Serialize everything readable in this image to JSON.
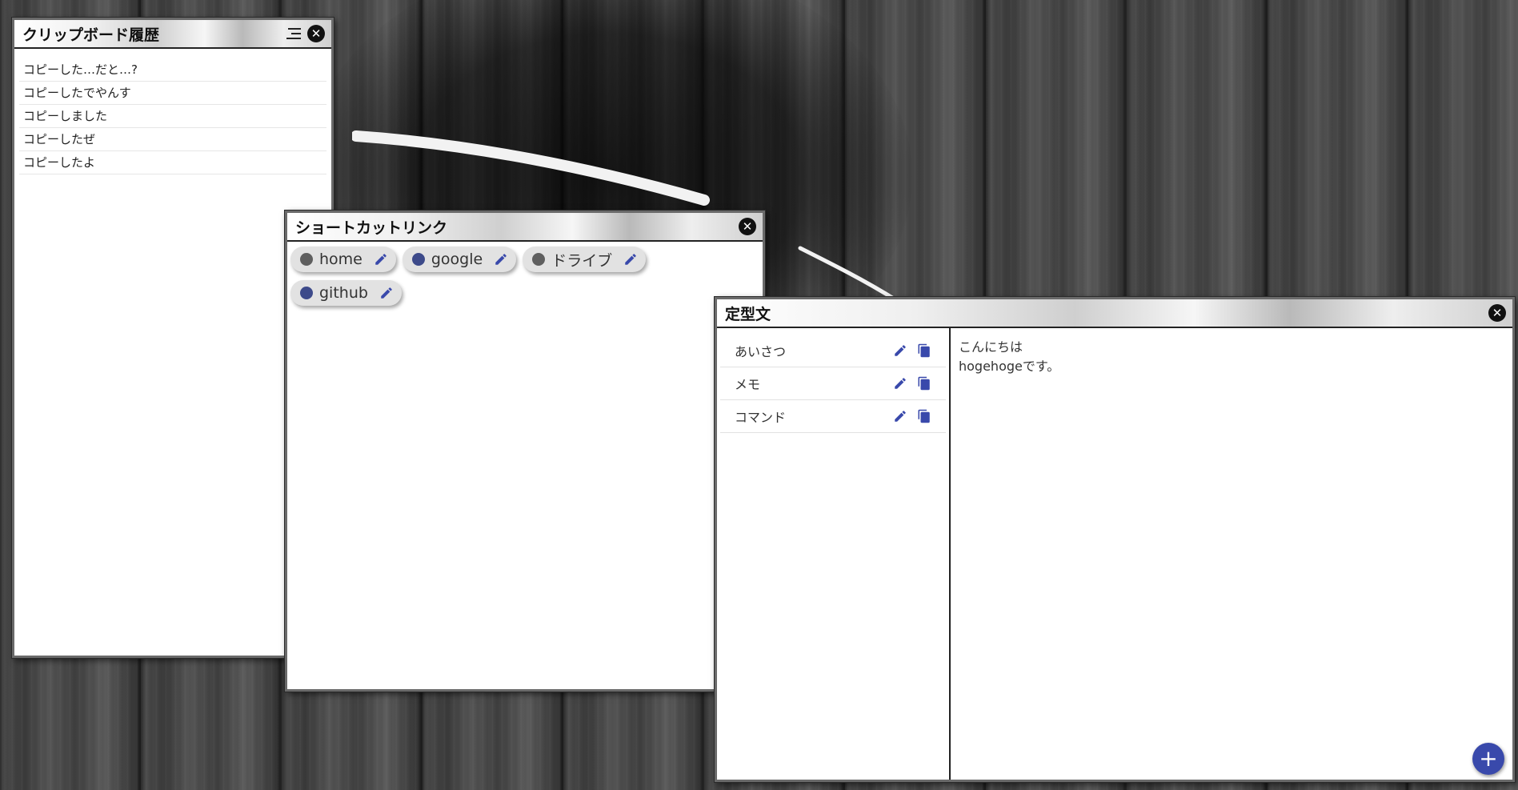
{
  "windows": {
    "clipboard": {
      "title": "クリップボード履歴",
      "items": [
        "コピーした…だと…?",
        "コピーしたでやんす",
        "コピーしました",
        "コピーしたぜ",
        "コピーしたよ"
      ]
    },
    "shortcuts": {
      "title": "ショートカットリンク",
      "links": [
        {
          "label": "home",
          "dot_color": "#5f5f5f"
        },
        {
          "label": "google",
          "dot_color": "#3d4a8a"
        },
        {
          "label": "ドライブ",
          "dot_color": "#5f5f5f"
        },
        {
          "label": "github",
          "dot_color": "#3d4a8a"
        }
      ]
    },
    "templates": {
      "title": "定型文",
      "items": [
        "あいさつ",
        "メモ",
        "コマンド"
      ],
      "content_line1": "こんにちは",
      "content_line2": "hogehogeです。",
      "add_button": "+"
    }
  },
  "colors": {
    "accent": "#3949ab",
    "icon": "#3949ab"
  }
}
